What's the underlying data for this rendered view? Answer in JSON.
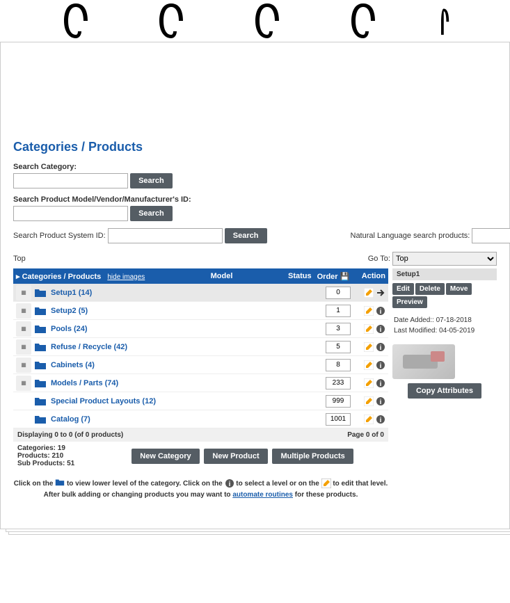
{
  "page_title": "Categories / Products",
  "search": {
    "category_label": "Search Category:",
    "product_id_label": "Search Product Model/Vendor/Manufacturer's ID:",
    "system_id_label": "Search Product System ID:",
    "natural_lang_label": "Natural Language search products:",
    "button": "Search"
  },
  "breadcrumb": "Top",
  "goto": {
    "label": "Go To:",
    "selected": "Top"
  },
  "table": {
    "header_categories": "Categories / Products",
    "hide_images": "hide images",
    "header_model": "Model",
    "header_status": "Status",
    "header_order": "Order",
    "header_action": "Action"
  },
  "rows": [
    {
      "name": "Setup1 (14)",
      "order": "0",
      "icons": "edit-arrow",
      "thumb": true,
      "selected": true
    },
    {
      "name": "Setup2 (5)",
      "order": "1",
      "icons": "edit-info",
      "thumb": true,
      "selected": false
    },
    {
      "name": "Pools (24)",
      "order": "3",
      "icons": "edit-info",
      "thumb": true,
      "selected": false
    },
    {
      "name": "Refuse / Recycle (42)",
      "order": "5",
      "icons": "edit-info",
      "thumb": true,
      "selected": false
    },
    {
      "name": "Cabinets (4)",
      "order": "8",
      "icons": "edit-info",
      "thumb": true,
      "selected": false
    },
    {
      "name": "Models / Parts (74)",
      "order": "233",
      "icons": "edit-info",
      "thumb": true,
      "selected": false
    },
    {
      "name": "Special Product Layouts (12)",
      "order": "999",
      "icons": "edit-info",
      "thumb": false,
      "selected": false
    },
    {
      "name": "Catalog (7)",
      "order": "1001",
      "icons": "edit-info",
      "thumb": false,
      "selected": false
    }
  ],
  "displaying": {
    "left": "Displaying 0 to 0 (of 0 products)",
    "right": "Page 0 of 0"
  },
  "stats": {
    "categories": "Categories: 19",
    "products": "Products: 210",
    "sub": "Sub Products:  51"
  },
  "buttons": {
    "new_category": "New Category",
    "new_product": "New Product",
    "multiple": "Multiple Products"
  },
  "help": {
    "line1_a": "Click on the ",
    "line1_b": " to view lower level of the category. Click on the ",
    "line1_c": " to select a level or on the ",
    "line1_d": " to edit that level.",
    "line2_a": "After bulk adding or changing products you may want to ",
    "line2_link": "automate routines",
    "line2_b": " for these products."
  },
  "detail": {
    "title": "Setup1",
    "edit": "Edit",
    "delete": "Delete",
    "move": "Move",
    "preview": "Preview",
    "date_added": "Date Added:: 07-18-2018",
    "last_modified": "Last Modified: 04-05-2019",
    "copy_attributes": "Copy Attributes"
  }
}
